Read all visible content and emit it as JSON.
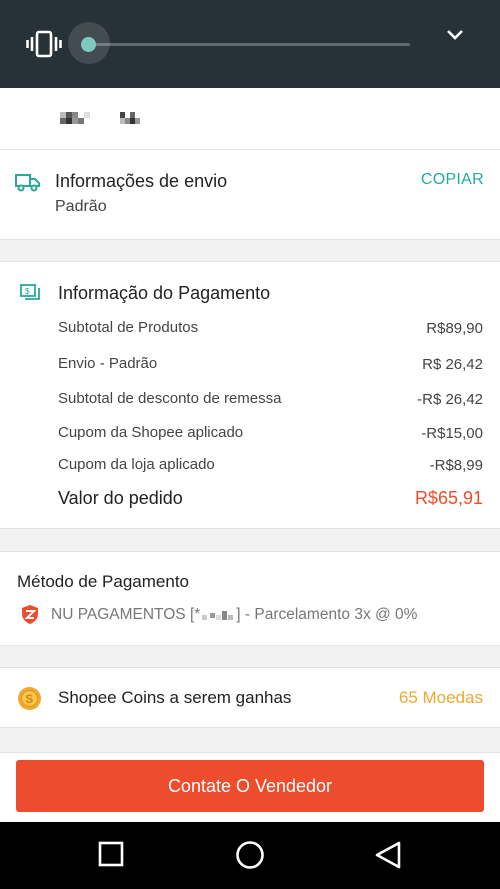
{
  "shipping": {
    "title": "Informações de envio",
    "subtitle": "Padrão",
    "copy_label": "COPIAR"
  },
  "payment_info": {
    "title": "Informação do Pagamento",
    "rows": [
      {
        "label": "Subtotal de Produtos",
        "value": "R$89,90"
      },
      {
        "label": "Envio - Padrão",
        "value": "R$ 26,42"
      },
      {
        "label": "Subtotal de desconto de remessa",
        "value": "-R$ 26,42"
      },
      {
        "label": "Cupom da Shopee aplicado",
        "value": "-R$15,00"
      },
      {
        "label": "Cupom da loja aplicado",
        "value": "-R$8,99"
      }
    ],
    "total_label": "Valor do pedido",
    "total_value": "R$65,91"
  },
  "payment_method": {
    "title": "Método de Pagamento",
    "method_prefix": "NU PAGAMENTOS [*",
    "method_suffix": "] - Parcelamento 3x @ 0%"
  },
  "coins": {
    "label": "Shopee Coins a serem ganhas",
    "value": "65 Moedas"
  },
  "contact_button": "Contate O Vendedor",
  "colors": {
    "accent": "#ee4d2d",
    "teal": "#26aa99",
    "coin": "#f0a930",
    "overlay": "#263238"
  },
  "volume": {
    "level": 0.0
  },
  "icons": [
    "vibrate-icon",
    "chevron-down-icon",
    "truck-icon",
    "money-icon",
    "shield-icon",
    "coin-icon",
    "recents-icon",
    "home-icon",
    "back-icon"
  ]
}
